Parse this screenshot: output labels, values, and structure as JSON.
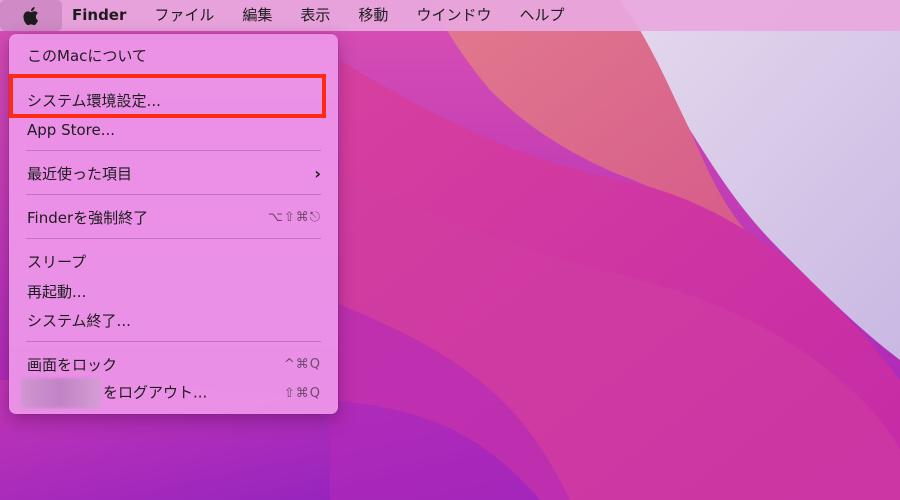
{
  "menubar": {
    "apple_icon": "apple-icon",
    "app_name": "Finder",
    "menus": [
      "ファイル",
      "編集",
      "表示",
      "移動",
      "ウインドウ",
      "ヘルプ"
    ]
  },
  "apple_menu": {
    "items": {
      "about": {
        "label": "このMacについて"
      },
      "system_prefs": {
        "label": "システム環境設定..."
      },
      "app_store": {
        "label": "App Store..."
      },
      "recent": {
        "label": "最近使った項目",
        "submenu_icon": "chevron-right-icon",
        "chevron": "›"
      },
      "force_quit": {
        "label": "Finderを強制終了",
        "shortcut": "⌥⇧⌘⎋"
      },
      "sleep": {
        "label": "スリープ"
      },
      "restart": {
        "label": "再起動..."
      },
      "shutdown": {
        "label": "システム終了..."
      },
      "lock": {
        "label": "画面をロック",
        "shortcut": "^⌘Q"
      },
      "logout": {
        "label": "をログアウト...",
        "shortcut": "⇧⌘Q"
      }
    }
  },
  "annotation": {
    "highlight_color": "#ff2a12"
  }
}
